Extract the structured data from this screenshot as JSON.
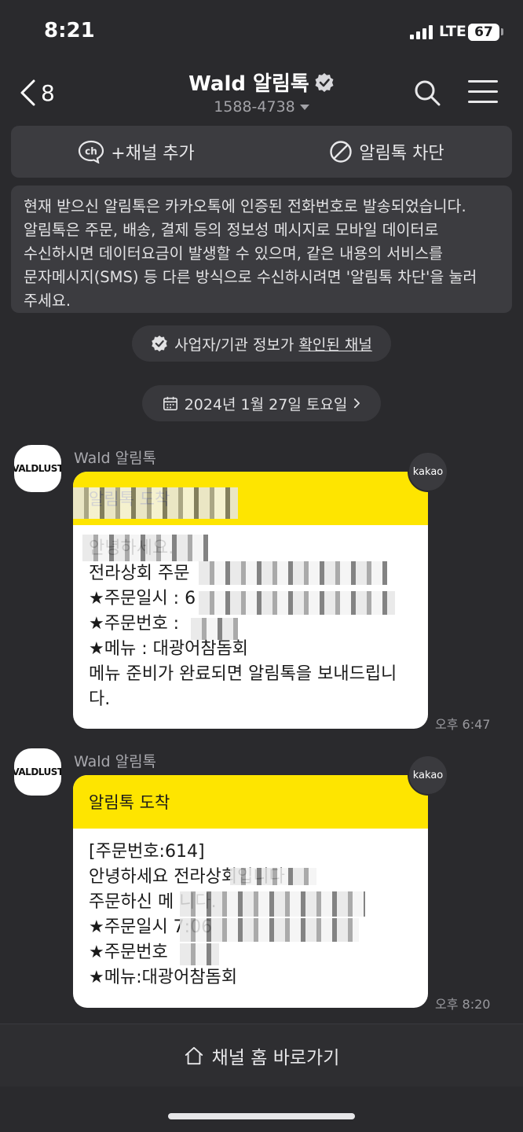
{
  "status": {
    "time": "8:21",
    "network": "LTE",
    "battery": "67",
    "battery_level": 0.67
  },
  "header": {
    "back_count": "8",
    "channel_name": "Wald 알림톡",
    "phone": "1588-4738"
  },
  "actions": {
    "add_channel": "+채널 추가",
    "block": "알림톡 차단"
  },
  "notice": "현재 받으신 알림톡은 카카오톡에 인증된 전화번호로 발송되었습니다. 알림톡은 주문, 배송, 결제 등의 정보성 메시지로 모바일 데이터로 수신하시면 데이터요금이 발생할 수 있으며, 같은 내용의 서비스를 문자메시지(SMS) 등 다른 방식으로 수신하시려면 '알림톡 차단'을 눌러 주세요.",
  "verified_info": {
    "text": "사업자/기관 정보가 ",
    "link": "확인된 채널"
  },
  "date_divider": "2024년 1월 27일 토요일",
  "messages": [
    {
      "avatar_text": "VALDLUST",
      "sender": "Wald 알림톡",
      "header": "알림톡 도착",
      "body": "안녕하세요.\n전라상회 주문\n★주문일시 : 6\n★주문번호 :\n★메뉴 : 대광어참돔회\n메뉴 준비가 완료되면 알림톡을 보내드립니다.",
      "badge": "kakao",
      "time": "오후 6:47"
    },
    {
      "avatar_text": "VALDLUST",
      "sender": "Wald 알림톡",
      "header": "알림톡 도착",
      "body": "[주문번호:614]\n안녕하세요 전라상회입니다\n주문하신 메 니다.\n★주문일시 7:06\n★주문번호\n★메뉴:대광어참돔회",
      "badge": "kakao",
      "time": "오후 8:20"
    }
  ],
  "bottom": {
    "home_button": "채널 홈 바로가기"
  },
  "colors": {
    "background": "#2a2a2d",
    "accent_yellow": "#fee500",
    "panel": "#3c3c40"
  }
}
